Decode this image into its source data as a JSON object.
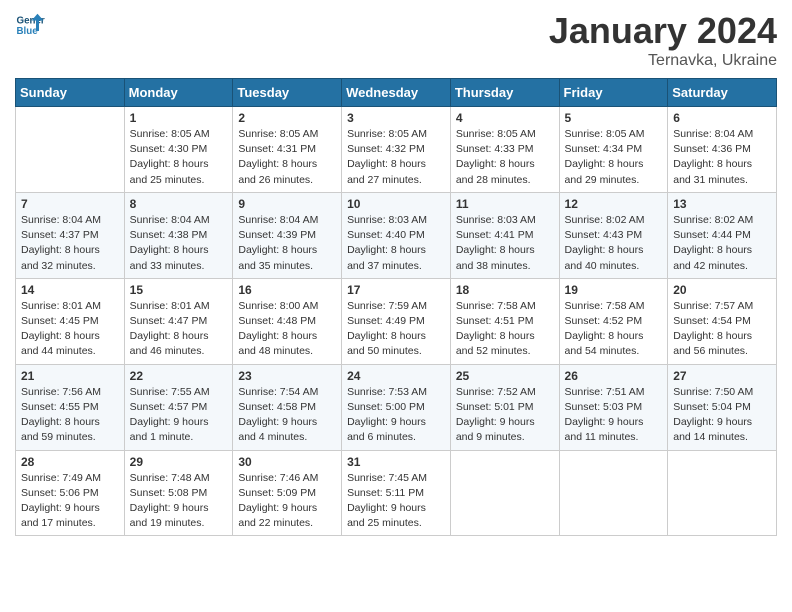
{
  "header": {
    "logo_line1": "General",
    "logo_line2": "Blue",
    "month": "January 2024",
    "location": "Ternavka, Ukraine"
  },
  "weekdays": [
    "Sunday",
    "Monday",
    "Tuesday",
    "Wednesday",
    "Thursday",
    "Friday",
    "Saturday"
  ],
  "weeks": [
    [
      {
        "day": "",
        "info": ""
      },
      {
        "day": "1",
        "info": "Sunrise: 8:05 AM\nSunset: 4:30 PM\nDaylight: 8 hours\nand 25 minutes."
      },
      {
        "day": "2",
        "info": "Sunrise: 8:05 AM\nSunset: 4:31 PM\nDaylight: 8 hours\nand 26 minutes."
      },
      {
        "day": "3",
        "info": "Sunrise: 8:05 AM\nSunset: 4:32 PM\nDaylight: 8 hours\nand 27 minutes."
      },
      {
        "day": "4",
        "info": "Sunrise: 8:05 AM\nSunset: 4:33 PM\nDaylight: 8 hours\nand 28 minutes."
      },
      {
        "day": "5",
        "info": "Sunrise: 8:05 AM\nSunset: 4:34 PM\nDaylight: 8 hours\nand 29 minutes."
      },
      {
        "day": "6",
        "info": "Sunrise: 8:04 AM\nSunset: 4:36 PM\nDaylight: 8 hours\nand 31 minutes."
      }
    ],
    [
      {
        "day": "7",
        "info": "Sunrise: 8:04 AM\nSunset: 4:37 PM\nDaylight: 8 hours\nand 32 minutes."
      },
      {
        "day": "8",
        "info": "Sunrise: 8:04 AM\nSunset: 4:38 PM\nDaylight: 8 hours\nand 33 minutes."
      },
      {
        "day": "9",
        "info": "Sunrise: 8:04 AM\nSunset: 4:39 PM\nDaylight: 8 hours\nand 35 minutes."
      },
      {
        "day": "10",
        "info": "Sunrise: 8:03 AM\nSunset: 4:40 PM\nDaylight: 8 hours\nand 37 minutes."
      },
      {
        "day": "11",
        "info": "Sunrise: 8:03 AM\nSunset: 4:41 PM\nDaylight: 8 hours\nand 38 minutes."
      },
      {
        "day": "12",
        "info": "Sunrise: 8:02 AM\nSunset: 4:43 PM\nDaylight: 8 hours\nand 40 minutes."
      },
      {
        "day": "13",
        "info": "Sunrise: 8:02 AM\nSunset: 4:44 PM\nDaylight: 8 hours\nand 42 minutes."
      }
    ],
    [
      {
        "day": "14",
        "info": "Sunrise: 8:01 AM\nSunset: 4:45 PM\nDaylight: 8 hours\nand 44 minutes."
      },
      {
        "day": "15",
        "info": "Sunrise: 8:01 AM\nSunset: 4:47 PM\nDaylight: 8 hours\nand 46 minutes."
      },
      {
        "day": "16",
        "info": "Sunrise: 8:00 AM\nSunset: 4:48 PM\nDaylight: 8 hours\nand 48 minutes."
      },
      {
        "day": "17",
        "info": "Sunrise: 7:59 AM\nSunset: 4:49 PM\nDaylight: 8 hours\nand 50 minutes."
      },
      {
        "day": "18",
        "info": "Sunrise: 7:58 AM\nSunset: 4:51 PM\nDaylight: 8 hours\nand 52 minutes."
      },
      {
        "day": "19",
        "info": "Sunrise: 7:58 AM\nSunset: 4:52 PM\nDaylight: 8 hours\nand 54 minutes."
      },
      {
        "day": "20",
        "info": "Sunrise: 7:57 AM\nSunset: 4:54 PM\nDaylight: 8 hours\nand 56 minutes."
      }
    ],
    [
      {
        "day": "21",
        "info": "Sunrise: 7:56 AM\nSunset: 4:55 PM\nDaylight: 8 hours\nand 59 minutes."
      },
      {
        "day": "22",
        "info": "Sunrise: 7:55 AM\nSunset: 4:57 PM\nDaylight: 9 hours\nand 1 minute."
      },
      {
        "day": "23",
        "info": "Sunrise: 7:54 AM\nSunset: 4:58 PM\nDaylight: 9 hours\nand 4 minutes."
      },
      {
        "day": "24",
        "info": "Sunrise: 7:53 AM\nSunset: 5:00 PM\nDaylight: 9 hours\nand 6 minutes."
      },
      {
        "day": "25",
        "info": "Sunrise: 7:52 AM\nSunset: 5:01 PM\nDaylight: 9 hours\nand 9 minutes."
      },
      {
        "day": "26",
        "info": "Sunrise: 7:51 AM\nSunset: 5:03 PM\nDaylight: 9 hours\nand 11 minutes."
      },
      {
        "day": "27",
        "info": "Sunrise: 7:50 AM\nSunset: 5:04 PM\nDaylight: 9 hours\nand 14 minutes."
      }
    ],
    [
      {
        "day": "28",
        "info": "Sunrise: 7:49 AM\nSunset: 5:06 PM\nDaylight: 9 hours\nand 17 minutes."
      },
      {
        "day": "29",
        "info": "Sunrise: 7:48 AM\nSunset: 5:08 PM\nDaylight: 9 hours\nand 19 minutes."
      },
      {
        "day": "30",
        "info": "Sunrise: 7:46 AM\nSunset: 5:09 PM\nDaylight: 9 hours\nand 22 minutes."
      },
      {
        "day": "31",
        "info": "Sunrise: 7:45 AM\nSunset: 5:11 PM\nDaylight: 9 hours\nand 25 minutes."
      },
      {
        "day": "",
        "info": ""
      },
      {
        "day": "",
        "info": ""
      },
      {
        "day": "",
        "info": ""
      }
    ]
  ]
}
